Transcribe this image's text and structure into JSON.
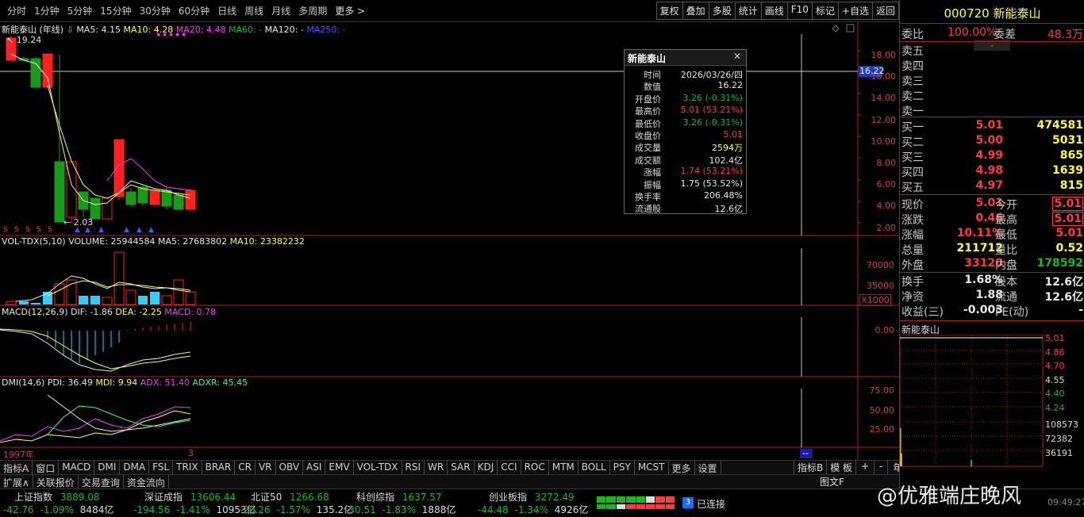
{
  "toolbar": {
    "periods": [
      "分时",
      "1分钟",
      "5分钟",
      "15分钟",
      "30分钟",
      "60分钟",
      "日线",
      "周线",
      "月线",
      "多周期",
      "更多 >"
    ],
    "right_buttons": [
      "复权",
      "叠加",
      "多股",
      "统计",
      "画线",
      "F10",
      "标记",
      "+自选",
      "返回"
    ]
  },
  "main_pane": {
    "stock_title": "新能泰山 (年线)",
    "ma5": "MA5: 4.15",
    "ma10": "MA10: 4.28",
    "ma20": "MA20: 4.48",
    "ma60": "MA60: -",
    "ma120": "MA120: -",
    "ma250": "MA250: -",
    "high_label": "19.24",
    "low_label": "2.03",
    "y_ticks": [
      "18.00",
      "16.00",
      "14.00",
      "12.00",
      "10.00",
      "8.00",
      "6.00",
      "4.00",
      "2.00"
    ],
    "cursor_price": "16.22"
  },
  "vol_pane": {
    "title": "VOL-TDX(5,10)",
    "volume": "VOLUME: 25944584",
    "ma5": "MA5: 27683802",
    "ma10": "MA10: 23382232",
    "y_ticks": [
      "70000",
      "35000"
    ],
    "unit": "X1000"
  },
  "macd_pane": {
    "title": "MACD(12,26,9)",
    "dif": "DIF: -1.86",
    "dea": "DEA: -2.25",
    "macd": "MACD: 0.78",
    "y_ticks": [
      "0.00"
    ]
  },
  "dmi_pane": {
    "title": "DMI(14,6)",
    "pdi": "PDI: 36.49",
    "mdi": "MDI: 9.94",
    "adx": "ADX: 51.40",
    "adxr": "ADXR: 45.45",
    "y_ticks": [
      "75.00",
      "50.00",
      "25.00"
    ]
  },
  "x_axis": {
    "start": "1997年",
    "end": "3",
    "cursor": "--"
  },
  "bottom_tabs": [
    "指标A",
    "窗口",
    "MACD",
    "DMI",
    "DMA",
    "FSL",
    "TRIX",
    "BRAR",
    "CR",
    "VR",
    "OBV",
    "ASI",
    "EMV",
    "VOL-TDX",
    "RSI",
    "WR",
    "SAR",
    "KDJ",
    "CCI",
    "ROC",
    "MTM",
    "BOLL",
    "PSY",
    "MCST",
    "更多",
    "设置"
  ],
  "bottom_right": [
    "指标B",
    "模 板",
    "+",
    "-",
    "年线"
  ],
  "bottom_tabs2": [
    "扩展∧",
    "关联报价",
    "交易查询",
    "资金流向"
  ],
  "bottom_right2": "图文F",
  "tooltip": {
    "title": "新能泰山",
    "rows": [
      {
        "k": "时间",
        "v": "2026/03/26/四",
        "c": "#e8e8e8"
      },
      {
        "k": "数值",
        "v": "16.22",
        "c": "#e8e8e8"
      },
      {
        "k": "开盘价",
        "v": "3.26 (-0.31%)",
        "c": "#1db61d"
      },
      {
        "k": "最高价",
        "v": "5.01 (53.21%)",
        "c": "#ff3b3b"
      },
      {
        "k": "最低价",
        "v": "3.26 (-0.31%)",
        "c": "#1db61d"
      },
      {
        "k": "收盘价",
        "v": "5.01",
        "c": "#ff3b3b"
      },
      {
        "k": "成交量",
        "v": "2594万",
        "c": "#ffff33"
      },
      {
        "k": "成交额",
        "v": "102.4亿",
        "c": "#e8e8e8"
      },
      {
        "k": "涨幅",
        "v": "1.74 (53.21%)",
        "c": "#ff3b3b"
      },
      {
        "k": "振幅",
        "v": "1.75 (53.52%)",
        "c": "#e8e8e8"
      },
      {
        "k": "换手率",
        "v": "206.48%",
        "c": "#e8e8e8"
      },
      {
        "k": "流通股",
        "v": "12.6亿",
        "c": "#e8e8e8"
      }
    ]
  },
  "quote": {
    "code": "000720",
    "name": "新能泰山",
    "weibi_label": "委比",
    "weibi": "100.00%",
    "weicha_label": "委差",
    "weicha": "48.3万",
    "sells": [
      "卖五",
      "卖四",
      "卖三",
      "卖二",
      "卖一"
    ],
    "buys": [
      {
        "l": "买一",
        "p": "5.01",
        "v": "474581"
      },
      {
        "l": "买二",
        "p": "5.00",
        "v": "5031"
      },
      {
        "l": "买三",
        "p": "4.99",
        "v": "865"
      },
      {
        "l": "买四",
        "p": "4.98",
        "v": "1639"
      },
      {
        "l": "买五",
        "p": "4.97",
        "v": "815"
      }
    ],
    "stats": [
      {
        "l": "现价",
        "v": "5.01",
        "l2": "今开",
        "v2": "5.01",
        "c": "#ff3b3b",
        "c2": "#ff3b3b",
        "box": true
      },
      {
        "l": "涨跌",
        "v": "0.46",
        "l2": "最高",
        "v2": "5.01",
        "c": "#ff3b3b",
        "c2": "#ff3b3b",
        "box": true
      },
      {
        "l": "涨幅",
        "v": "10.11%",
        "l2": "最低",
        "v2": "5.01",
        "c": "#ff3b3b",
        "c2": "#ff3b3b"
      },
      {
        "l": "总量",
        "v": "211712",
        "l2": "量比",
        "v2": "0.52",
        "c": "#ffff33",
        "c2": "#ffff33"
      },
      {
        "l": "外盘",
        "v": "33120",
        "l2": "内盘",
        "v2": "178592",
        "c": "#ff3b3b",
        "c2": "#1db61d"
      }
    ],
    "stats2": [
      {
        "l": "换手",
        "v": "1.68%",
        "l2": "股本",
        "v2": "12.6亿"
      },
      {
        "l": "净资",
        "v": "1.88",
        "l2": "流通",
        "v2": "12.6亿"
      },
      {
        "l": "收益(三)",
        "v": "-0.003",
        "l2": "PE(动)",
        "v2": "-"
      }
    ],
    "mini_title": "新能泰山",
    "mini_price_ticks": [
      "5.01",
      "4.86",
      "4.70",
      "4.55",
      "4.40",
      "4.24"
    ],
    "mini_vol_ticks": [
      "108573",
      "72382",
      "36191"
    ]
  },
  "status_indices": [
    {
      "name": "上证指数",
      "val": "3889.08",
      "chg": "-42.76",
      "pct": "-1.09%",
      "amt": "8484亿"
    },
    {
      "name": "深证成指",
      "val": "13606.44",
      "chg": "-194.56",
      "pct": "-1.41%",
      "amt": "10953亿"
    },
    {
      "name": "北证50",
      "val": "1266.68",
      "chg": "-20.26",
      "pct": "-1.57%",
      "amt": "135.2亿"
    },
    {
      "name": "科创综指",
      "val": "1637.57",
      "chg": "-30.51",
      "pct": "-1.83%",
      "amt": "1888亿"
    },
    {
      "name": "创业板指",
      "val": "3272.49",
      "chg": "-44.48",
      "pct": "-1.34%",
      "amt": "4926亿"
    }
  ],
  "status_conn": "已连接",
  "status_conn_num": "3",
  "watermark": "@优雅端庄晚风",
  "status_time": "09:49:27"
}
